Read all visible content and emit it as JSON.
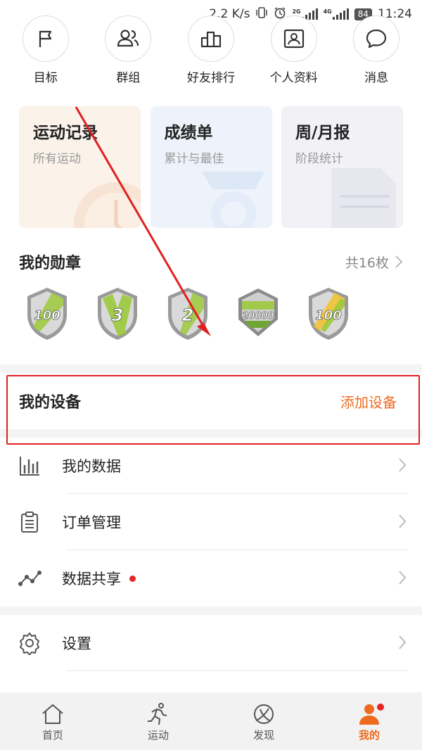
{
  "status": {
    "speed": "2.2 K/s",
    "net1": "2G",
    "net2": "4G",
    "battery": "84",
    "time": "11:24"
  },
  "top_icons": [
    {
      "label": "目标",
      "icon": "flag-icon"
    },
    {
      "label": "群组",
      "icon": "group-icon"
    },
    {
      "label": "好友排行",
      "icon": "ranking-icon"
    },
    {
      "label": "个人资料",
      "icon": "profile-card-icon"
    },
    {
      "label": "消息",
      "icon": "message-icon"
    }
  ],
  "cards": [
    {
      "title": "运动记录",
      "subtitle": "所有运动"
    },
    {
      "title": "成绩单",
      "subtitle": "累计与最佳"
    },
    {
      "title": "周/月报",
      "subtitle": "阶段统计"
    }
  ],
  "medals": {
    "title": "我的勋章",
    "count": "共16枚",
    "items": [
      {
        "text": "100"
      },
      {
        "text": "3"
      },
      {
        "text": "2"
      },
      {
        "text": "20000"
      },
      {
        "text": "100"
      }
    ]
  },
  "device": {
    "title": "我的设备",
    "action": "添加设备"
  },
  "menu": [
    {
      "label": "我的数据",
      "icon": "bar-chart-icon"
    },
    {
      "label": "订单管理",
      "icon": "clipboard-icon"
    },
    {
      "label": "数据共享",
      "icon": "share-graph-icon",
      "dot": true
    },
    {
      "label": "设置",
      "icon": "gear-icon"
    }
  ],
  "tabs": [
    {
      "label": "首页",
      "icon": "home-icon"
    },
    {
      "label": "运动",
      "icon": "running-icon"
    },
    {
      "label": "发现",
      "icon": "discover-icon"
    },
    {
      "label": "我的",
      "icon": "user-icon",
      "active": true
    }
  ],
  "colors": {
    "accent": "#ee6a1e",
    "annotation_red": "#e02020"
  }
}
